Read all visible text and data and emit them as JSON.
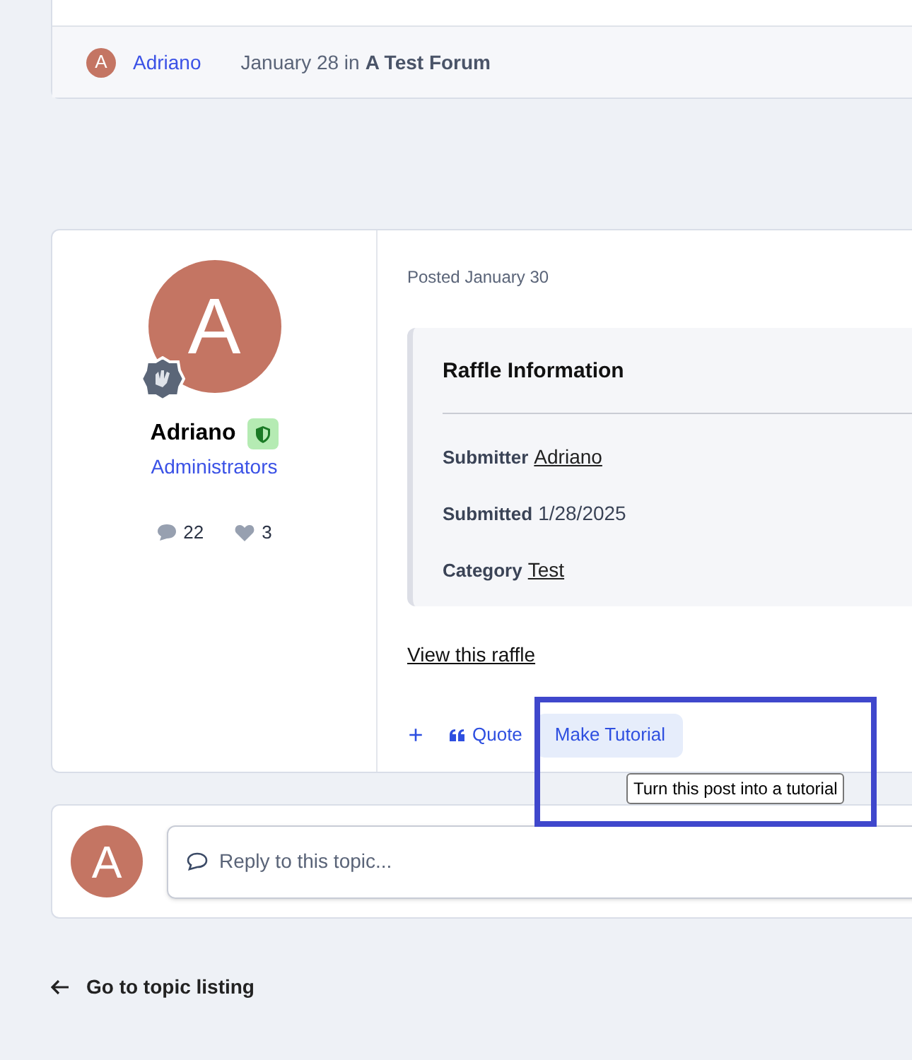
{
  "previous_post": {
    "author_initial": "A",
    "author": "Adriano",
    "date": "January 28 in",
    "forum": "A Test Forum"
  },
  "post": {
    "avatar_initial": "A",
    "author": "Adriano",
    "group": "Administrators",
    "comments": "22",
    "likes": "3",
    "posted": "Posted January 30",
    "info": {
      "title": "Raffle Information",
      "rows": [
        {
          "label": "Submitter",
          "value": "Adriano",
          "link": true
        },
        {
          "label": "Submitted",
          "value": "1/28/2025",
          "link": false
        },
        {
          "label": "Category",
          "value": "Test",
          "link": true
        }
      ]
    },
    "view_link": "View this raffle",
    "actions": [
      {
        "kind": "plus",
        "label": "+"
      },
      {
        "kind": "quote",
        "label": "Quote"
      },
      {
        "kind": "highlight",
        "label": "Make Tutorial"
      }
    ],
    "tooltip": "Turn this post into a tutorial"
  },
  "reply": {
    "avatar_initial": "A",
    "placeholder": "Reply to this topic..."
  },
  "back_link": "Go to topic listing"
}
